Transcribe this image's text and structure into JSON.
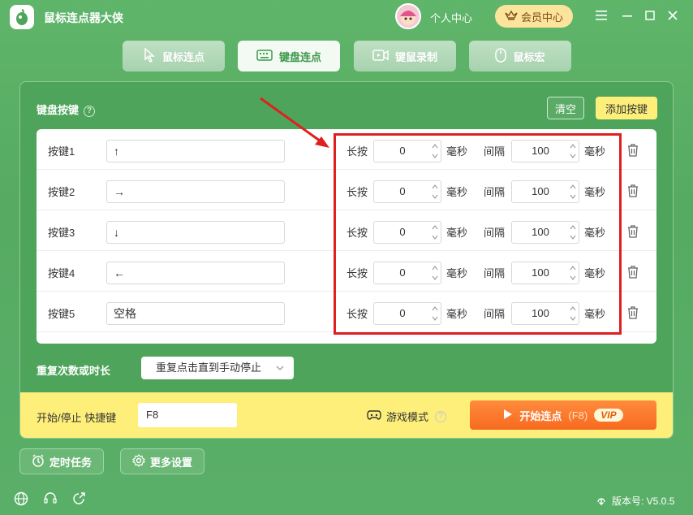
{
  "app": {
    "title": "鼠标连点器大侠"
  },
  "header": {
    "user_center": "个人中心",
    "vip_center": "会员中心"
  },
  "tabs": [
    {
      "label": "鼠标连点",
      "icon": "cursor-icon",
      "active": false
    },
    {
      "label": "键盘连点",
      "icon": "keyboard-icon",
      "active": true
    },
    {
      "label": "键鼠录制",
      "icon": "record-icon",
      "active": false
    },
    {
      "label": "鼠标宏",
      "icon": "mouse-icon",
      "active": false
    }
  ],
  "panel": {
    "title": "键盘按键",
    "clear_label": "清空",
    "add_label": "添加按键",
    "rows": [
      {
        "label": "按键1",
        "key": "↑",
        "hold_label": "长按",
        "hold": "0",
        "hold_unit": "毫秒",
        "interval_label": "间隔",
        "interval": "100",
        "interval_unit": "毫秒"
      },
      {
        "label": "按键2",
        "key": "→",
        "hold_label": "长按",
        "hold": "0",
        "hold_unit": "毫秒",
        "interval_label": "间隔",
        "interval": "100",
        "interval_unit": "毫秒"
      },
      {
        "label": "按键3",
        "key": "↓",
        "hold_label": "长按",
        "hold": "0",
        "hold_unit": "毫秒",
        "interval_label": "间隔",
        "interval": "100",
        "interval_unit": "毫秒"
      },
      {
        "label": "按键4",
        "key": "←",
        "hold_label": "长按",
        "hold": "0",
        "hold_unit": "毫秒",
        "interval_label": "间隔",
        "interval": "100",
        "interval_unit": "毫秒"
      },
      {
        "label": "按键5",
        "key": "空格",
        "hold_label": "长按",
        "hold": "0",
        "hold_unit": "毫秒",
        "interval_label": "间隔",
        "interval": "100",
        "interval_unit": "毫秒"
      }
    ],
    "repeat_label": "重复次数或时长",
    "repeat_value": "重复点击直到手动停止",
    "hotkey_label": "开始/停止 快捷键",
    "hotkey_value": "F8",
    "game_mode_label": "游戏模式",
    "start_label": "开始连点",
    "start_hotkey": "(F8)",
    "vip_badge": "VIP"
  },
  "bottom": {
    "timer_label": "定时任务",
    "settings_label": "更多设置",
    "version": "版本号: V5.0.5"
  },
  "colors": {
    "green": "#56aa62",
    "yellow": "#fdef7a",
    "orange": "#f76a1f",
    "highlight": "#e02020"
  }
}
